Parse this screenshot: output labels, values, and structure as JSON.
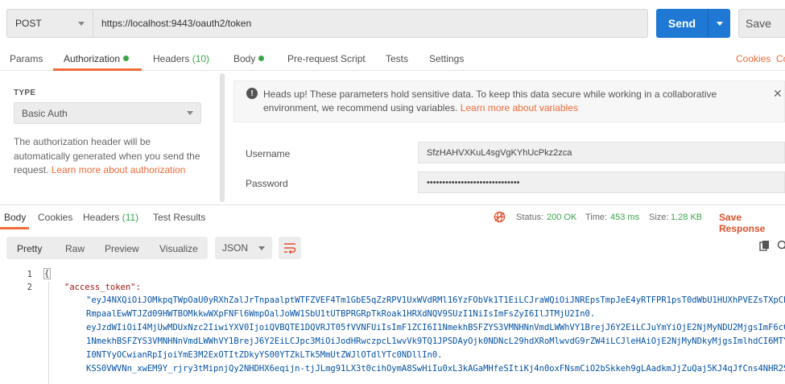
{
  "request": {
    "method": "POST",
    "url": "https://localhost:9443/oauth2/token",
    "send_label": "Send",
    "save_label": "Save"
  },
  "request_tabs": {
    "params": "Params",
    "authorization": "Authorization",
    "headers": "Headers",
    "headers_count": "(10)",
    "body": "Body",
    "prerequest": "Pre-request Script",
    "tests": "Tests",
    "settings": "Settings",
    "cookies": "Cookies",
    "cookies_cut": "Co"
  },
  "auth": {
    "type_label": "TYPE",
    "type_value": "Basic Auth",
    "description": "The authorization header will be automatically generated when you send the request.",
    "learn_more": "Learn more about authorization"
  },
  "notice": {
    "text": "Heads up! These parameters hold sensitive data. To keep this data secure while working in a collaborative environment, we recommend using variables.",
    "link": "Learn more about variables"
  },
  "fields": {
    "username_label": "Username",
    "username_value": "SfzHAHVXKuL4sgVgKYhUcPkz2zca",
    "password_label": "Password",
    "password_value": "••••••••••••••••••••••••••••••"
  },
  "response_tabs": {
    "body": "Body",
    "cookies": "Cookies",
    "headers": "Headers",
    "headers_count": "(11)",
    "test_results": "Test Results"
  },
  "response_status": {
    "status_label": "Status:",
    "status_value": "200 OK",
    "time_label": "Time:",
    "time_value": "453 ms",
    "size_label": "Size:",
    "size_value": "1.28 KB",
    "save_response": "Save Response"
  },
  "view_options": {
    "pretty": "Pretty",
    "raw": "Raw",
    "preview": "Preview",
    "visualize": "Visualize",
    "format": "JSON"
  },
  "code": {
    "line1": "1",
    "line2": "2",
    "brace": "{",
    "key": "\"access_token\":",
    "value_lines": [
      "\"eyJ4NXQiOiJOMkpqTWpOaU0yRXhZalJrTnpaalptWTFZVEF4Tm1GbE5qZzRPV1UxWVdRMl16YzFObVk1T1EiLCJraWQiOiJNREpsTmpJeE4yRTFPR1psT0dWbU1HUXhPVEZsTXpCbU5t",
      "RmpaalEwWTJZd09HWTBOMkkwWXpFNFl6WmpOalJoWW1SbU1tUTBPRGRpTkRoak1HRXdNQV9SUzI1NiIsImFsZyI6IlJTMjU2In0.",
      "eyJzdWIiOiI4MjUwMDUxNzc2IiwiYXV0IjoiQVBQTE1DQVRJT05fVVNFUiIsImF1ZCI6I1NmekhBSFZYS3VMNHNnVmdLWWhVY1BrejJ6Y2EiLCJuYmYiOjE2NjMyNDU2MjgsImF6cCI6I",
      "1NmekhBSFZYS3VMNHNnVmdLWWhVY1BrejJ6Y2EiLCJpc3MiOiJodHRwczpcL1wvVk9TQ1JPSDAyOjk0NDNcL29hdXRoMlwvdG9rZW4iLCJleHAiOjE2NjMyNDkyMjgsImlhdCI6MTY2Mz",
      "I0NTYyOCwianRpIjoiYmE3M2ExOTItZDkyYS00YTZkLTk5MmUtZWJlOTdlYTc0NDllIn0.",
      "KSS0VWVNn_xwEM9Y_rjry3tMipnjQy2NHDHX6eqijn-tjJLmg91LX3t0cihOymA8SwHiIu0xL3kAGaMHfeSItiKj4n0oxFNsmCiO2bSkkeh9gLAadkmJjZuQaj5KJ4qJfCns4NHR2S4pf"
    ]
  },
  "colors": {
    "accent": "#f26b3a",
    "send_blue": "#1e78d4",
    "success_green": "#3aa64b"
  }
}
